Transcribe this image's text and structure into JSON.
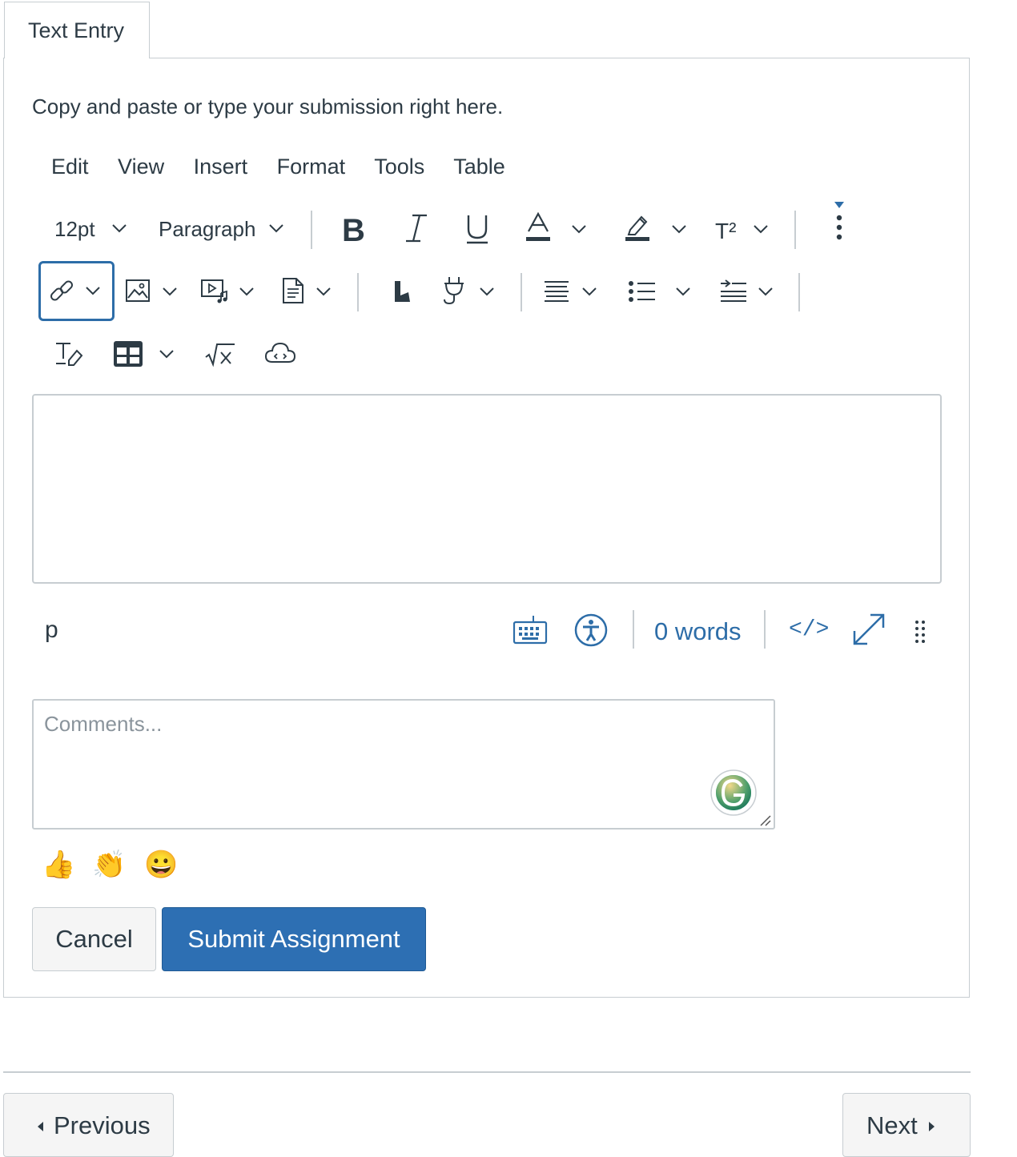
{
  "tab": {
    "label": "Text Entry"
  },
  "instructions": "Copy and paste or type your submission right here.",
  "menubar": [
    "Edit",
    "View",
    "Insert",
    "Format",
    "Tools",
    "Table"
  ],
  "toolbar": {
    "font_size": "12pt",
    "block_format": "Paragraph",
    "superscript_label": "T²"
  },
  "editor": {
    "content": ""
  },
  "statusbar": {
    "element_path": "p",
    "word_count": "0 words",
    "html_toggle": "</>"
  },
  "comments": {
    "placeholder": "Comments...",
    "value": ""
  },
  "reactions": [
    "👍",
    "👏",
    "😀"
  ],
  "buttons": {
    "cancel": "Cancel",
    "submit": "Submit Assignment"
  },
  "nav": {
    "previous": "Previous",
    "next": "Next"
  },
  "colors": {
    "accent": "#2d6fb3",
    "link": "#2d6da8",
    "border": "#c7cdd1",
    "text": "#2d3b45",
    "focus": "#2d6da8"
  }
}
